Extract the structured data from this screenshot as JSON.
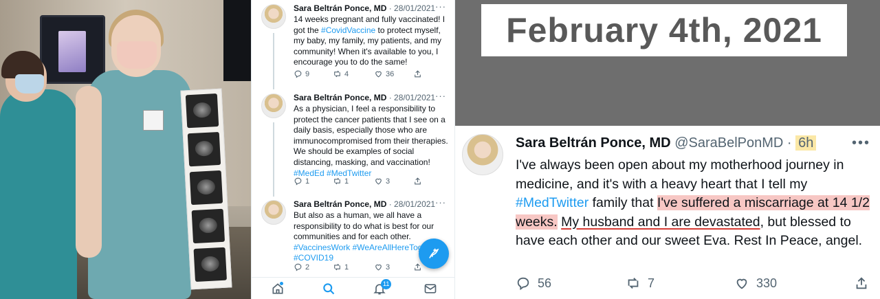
{
  "photo": {},
  "feed": {
    "tweets": [
      {
        "name": "Sara Beltrán Ponce, MD",
        "date": "· 28/01/2021",
        "more": "···",
        "text_parts": [
          "14 weeks pregnant and fully vaccinated! I got the ",
          "#CovidVaccine",
          " to protect myself, my baby, my family, my patients, and my community! When it's available to you, I encourage you to do the same!"
        ],
        "replies": "9",
        "retweets": "4",
        "likes": "36"
      },
      {
        "name": "Sara Beltrán Ponce, MD",
        "date": "· 28/01/2021",
        "more": "···",
        "text_parts": [
          "As a physician, I feel a responsibility to protect the cancer patients that I see on a daily basis, especially those who are immunocompromised from their therapies. We should be examples of social distancing, masking, and vaccination! ",
          "#MedEd #MedTwitter"
        ],
        "replies": "1",
        "retweets": "1",
        "likes": "3"
      },
      {
        "name": "Sara Beltrán Ponce, MD",
        "date": "· 28/01/2021",
        "more": "···",
        "text_parts": [
          "But also as a human, we all have a responsibility to do what is best for our communities and for each other. ",
          "#VaccinesWork #WeAreAllHereTog",
          "#COVID19"
        ],
        "replies": "2",
        "retweets": "1",
        "likes": "3"
      }
    ],
    "tabbar": {
      "notifications_count": "11",
      "icons": [
        "home-icon",
        "search-icon",
        "bell-icon",
        "mail-icon"
      ]
    },
    "fab_icon": "compose-tweet-icon"
  },
  "right": {
    "date_banner": "February 4th, 2021",
    "tweet": {
      "name": "Sara Beltrán Ponce, MD",
      "handle": "@SaraBelPonMD",
      "sep": " · ",
      "time": "6h",
      "more": "•••",
      "text": {
        "p1": "I've always been open about my motherhood journey in medicine, and it's with a heavy heart that I tell my ",
        "tag": "#MedTwitter",
        "p2": " family that ",
        "hl": "I've suffered a miscarriage at 14 1/2 weeks.",
        "p3": " ",
        "ul": "My husband and I are devastated",
        "p4": ", but blessed to have each other and our sweet Eva. Rest In Peace, angel."
      },
      "replies": "56",
      "retweets": "7",
      "likes": "330"
    }
  },
  "colors": {
    "twitter_blue": "#1d9bf0",
    "highlight_red": "#f7c7c4",
    "highlight_yellow": "#fbe8a6",
    "panel_gray": "#6e6e6e"
  }
}
